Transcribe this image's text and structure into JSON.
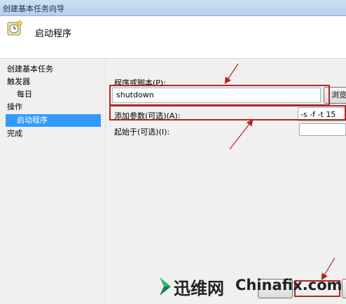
{
  "window": {
    "title": "创建基本任务向导"
  },
  "header": {
    "title": "启动程序"
  },
  "nav": {
    "items": [
      {
        "label": "创建基本任务"
      },
      {
        "label": "触发器"
      },
      {
        "label": "每日"
      },
      {
        "label": "操作"
      },
      {
        "label": "启动程序"
      },
      {
        "label": "完成"
      }
    ]
  },
  "form": {
    "program_label": "程序或脚本(P):",
    "program_value": "shutdown",
    "browse_label": "浏览",
    "args_label": "添加参数(可选)(A):",
    "args_value": "-s -f -t 15",
    "start_in_label": "起始于(可选)(I):",
    "start_in_value": ""
  },
  "watermark": {
    "cn": "迅维网",
    "en": "Chinafix.com"
  },
  "colors": {
    "highlight": "#b52424",
    "nav_selected": "#3399ff",
    "watermark_green": "#2bb673"
  },
  "icons": {
    "wizard": "task-clock-icon",
    "watermark_logo": "chevron-logo-icon"
  }
}
